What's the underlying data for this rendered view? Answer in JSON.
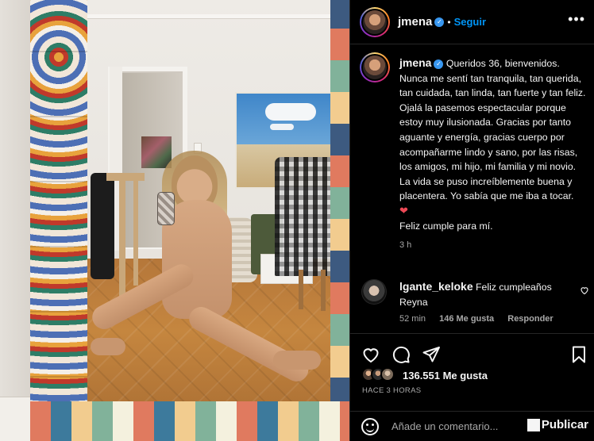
{
  "header": {
    "username": "jmena",
    "verified_badge": "✓",
    "separator": "•",
    "follow_label": "Seguir",
    "more_icon": "•••"
  },
  "post": {
    "username": "jmena",
    "caption": "Queridos 36, bienvenidos. Nunca me sentí tan tranquila, tan querida, tan cuidada, tan linda, tan fuerte y tan feliz. Ojalá la pasemos espectacular porque estoy muy ilusionada. Gracias por tanto aguante y energía, gracias cuerpo por acompañarme lindo y sano, por las risas, los amigos, mi hijo, mi familia y mi novio. La vida se puso increíblemente buena y placentera. Yo sabía que me iba a tocar.",
    "heart_emoji": "❤",
    "signoff": "Feliz cumple para mí.",
    "time": "3 h"
  },
  "comment": {
    "username": "lgante_keloke",
    "text": "Feliz cumpleaños Reyna",
    "time": "52 min",
    "likes": "146 Me gusta",
    "reply_label": "Responder"
  },
  "actions": {
    "likes_count": "136.551 Me gusta",
    "posted_ago": "HACE 3 HORAS"
  },
  "add_comment": {
    "placeholder": "Añade un comentario...",
    "publish_label": "Publicar"
  },
  "colors": {
    "accent": "#0095f6",
    "verified": "#3897f0",
    "heart": "#ed4956",
    "muted": "#a8a8a8",
    "background": "#000000"
  }
}
